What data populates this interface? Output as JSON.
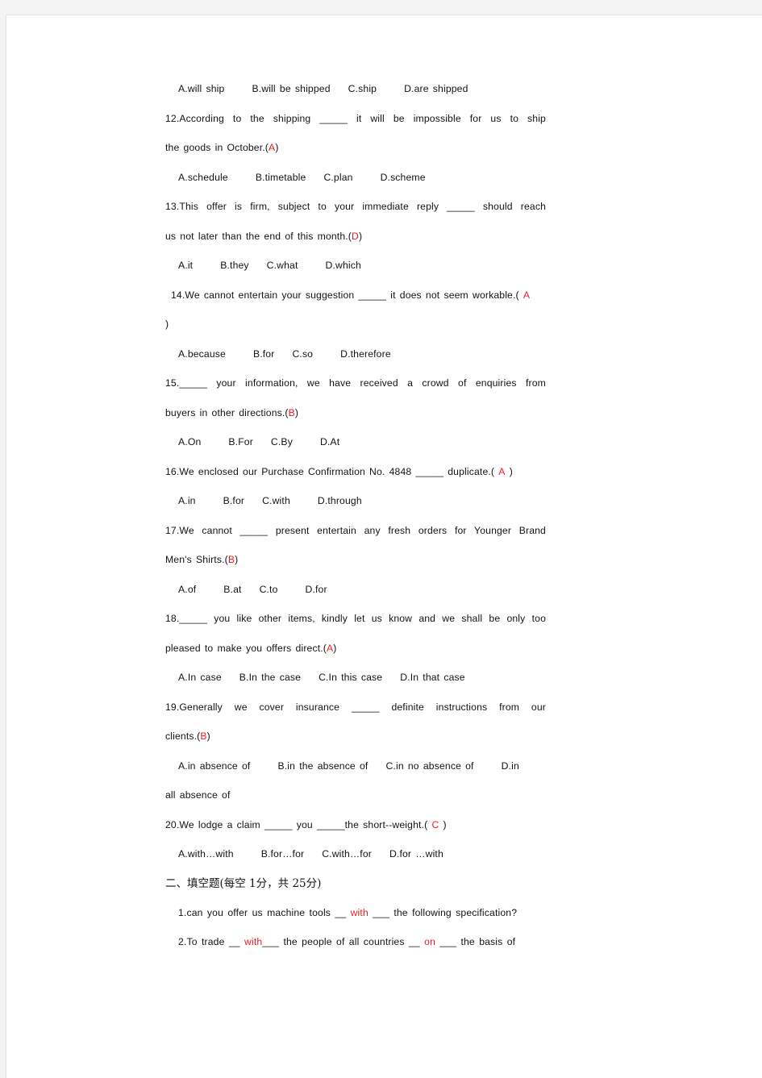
{
  "document": {
    "title": "Business English exam paper - multiple choice and fill-in-the-blank",
    "answer_color": "#ef1b23",
    "text_color": "#131313"
  },
  "trailing_options_prev": {
    "label": "A.will ship",
    "b": "B.will be shipped",
    "c": "C.ship",
    "d": "D.are shipped"
  },
  "questions": [
    {
      "id": "q12",
      "stem": "12.According to the shipping _____ it will be impossible for us to ship",
      "stem_cont": "the goods in October.(",
      "answer": "A",
      "stem_cont_end": ")",
      "options": {
        "a": "A.schedule",
        "b": "B.timetable",
        "c": "C.plan",
        "d": "D.scheme"
      }
    },
    {
      "id": "q13",
      "stem": "13.This offer is firm, subject to your immediate reply _____ should reach",
      "stem_cont": "us not later than the end of this month.(",
      "answer": "D",
      "stem_cont_end": ")",
      "options": {
        "a": "A.it",
        "b": "B.they",
        "c": "C.what",
        "d": "D.which"
      }
    },
    {
      "id": "q14",
      "stem": "14.We cannot entertain your suggestion _____ it does not seem workable.(",
      "answer": "A",
      "stem_cont": ")",
      "options": {
        "a": "A.because",
        "b": "B.for",
        "c": "C.so",
        "d": "D.therefore"
      }
    },
    {
      "id": "q15",
      "stem": "15._____ your information, we have received a crowd of enquiries from",
      "stem_cont": "buyers in other directions.(",
      "answer": "B",
      "stem_cont_end": ")",
      "options": {
        "a": "A.On",
        "b": "B.For",
        "c": "C.By",
        "d": "D.At"
      }
    },
    {
      "id": "q16",
      "stem": "16.We enclosed our Purchase Confirmation No. 4848 _____ duplicate.(",
      "answer": "A",
      "stem_cont": ")",
      "options": {
        "a": "A.in",
        "b": "B.for",
        "c": "C.with",
        "d": "D.through"
      }
    },
    {
      "id": "q17",
      "stem": "17.We cannot _____ present entertain any fresh orders for Younger Brand",
      "stem_cont": "Men's Shirts.(",
      "answer": "B",
      "stem_cont_end": ")",
      "options": {
        "a": "A.of",
        "b": "B.at",
        "c": "C.to",
        "d": "D.for"
      }
    },
    {
      "id": "q18",
      "stem": "18._____ you like other items, kindly let us know and we shall be only too",
      "stem_cont": "pleased to make you offers direct.(",
      "answer": "A",
      "stem_cont_end": ")",
      "options": {
        "a": "A.In case",
        "b": "B.In the case",
        "c": "C.In this case",
        "d": "D.In that case"
      }
    },
    {
      "id": "q19",
      "stem": "19.Generally we cover insurance _____ definite instructions from our",
      "stem_cont": "clients.(",
      "answer": "B",
      "stem_cont_end": ")",
      "options": {
        "a": "A.in absence of",
        "b": "B.in the absence of",
        "c": "C.in no absence of",
        "d": "D.in"
      },
      "options_cont": "all absence of"
    },
    {
      "id": "q20",
      "stem": "20.We lodge a claim _____ you _____the short--weight.(",
      "answer": "C",
      "stem_cont": ")",
      "options": {
        "a": "A.with…with",
        "b": "B.for…for",
        "c": "C.with…for",
        "d": "D.for …with"
      }
    }
  ],
  "section_two": {
    "heading": "二、填空题(每空 1分，共 25分)",
    "items": [
      {
        "id": "fill1",
        "before": "1.can you offer us machine tools __",
        "answer": "with",
        "after": "___ the following specification?"
      },
      {
        "id": "fill2",
        "before": "2.To trade __",
        "answer": "with",
        "mid": "___ the people of all countries __",
        "answer2": "on",
        "after": "___ the basis of"
      }
    ]
  }
}
